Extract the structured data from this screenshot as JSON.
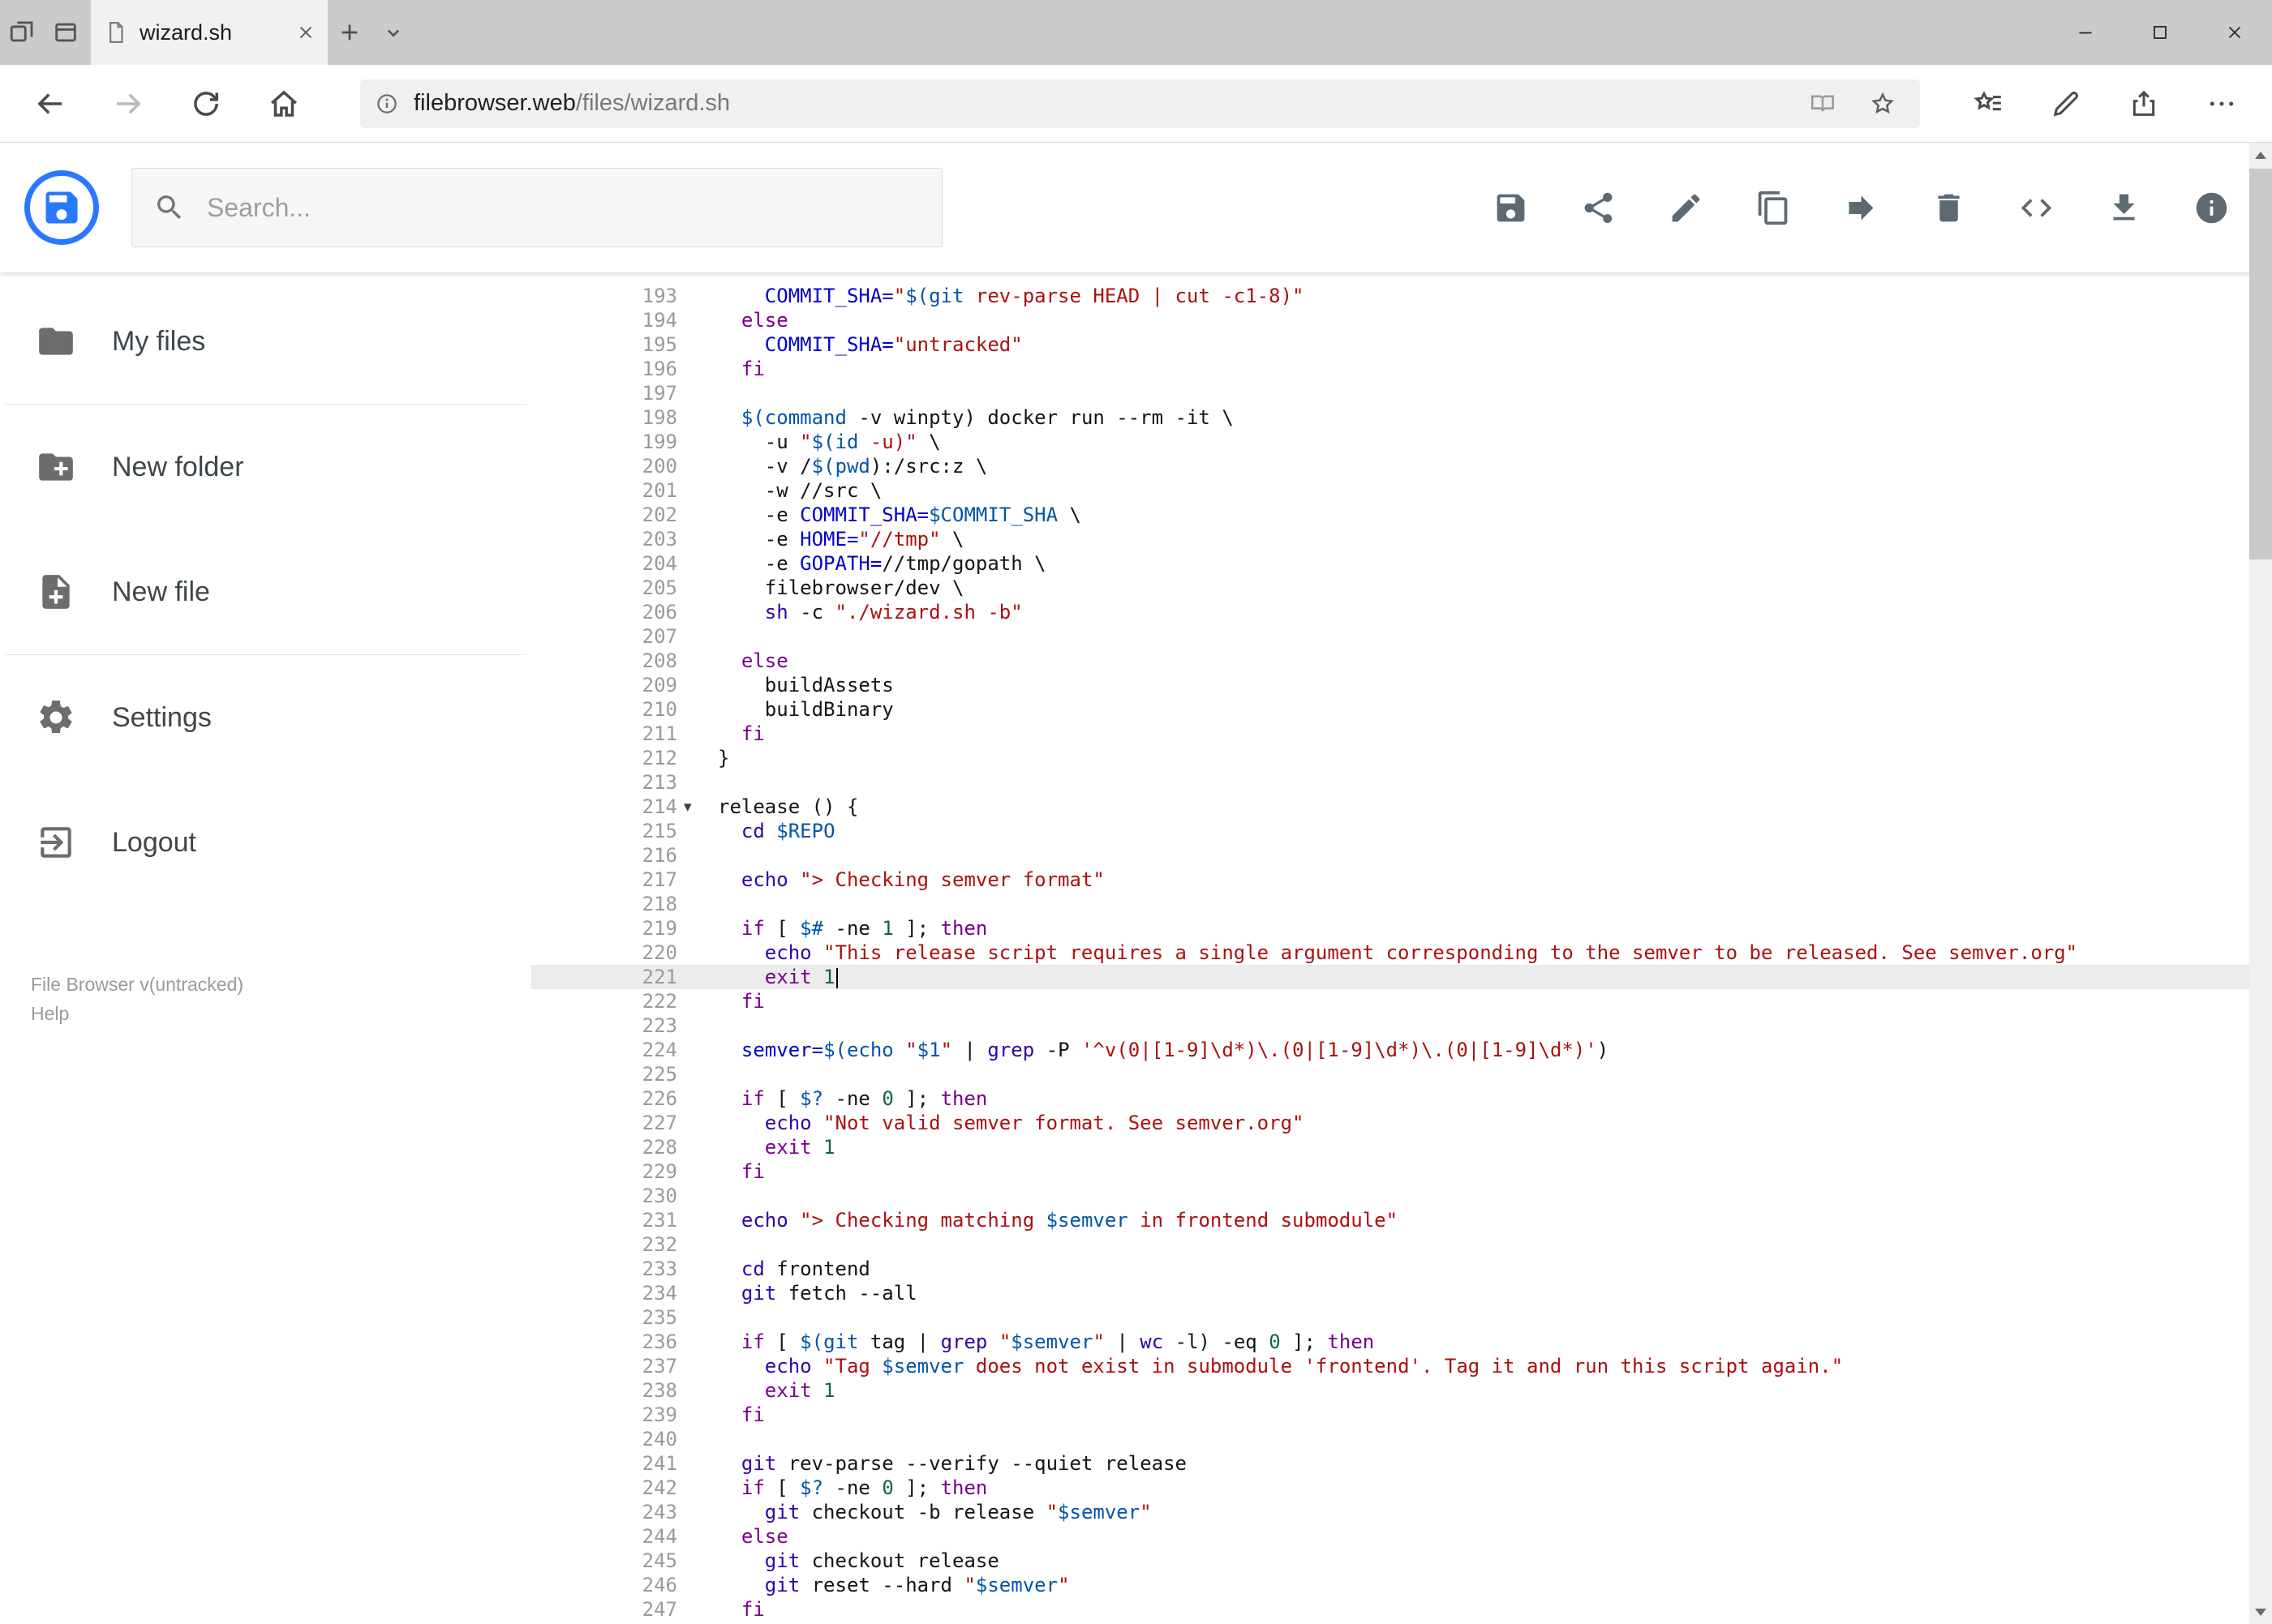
{
  "browser": {
    "tab": {
      "title": "wizard.sh"
    },
    "address": {
      "host": "filebrowser.web",
      "path": "/files/wizard.sh"
    },
    "titlebar_icons": [
      "set-tabs-aside-icon",
      "tabs-preview-icon",
      "new-tab-icon",
      "tab-preview-chevron-icon"
    ],
    "nav_icons": [
      "back-icon",
      "forward-icon",
      "refresh-icon",
      "home-icon",
      "info-icon",
      "reading-view-icon",
      "favorite-star-icon",
      "hub-icon",
      "annotate-pen-icon",
      "share-icon",
      "more-icon"
    ],
    "window_controls": [
      "minimize-icon",
      "maximize-icon",
      "close-icon"
    ]
  },
  "header": {
    "search": {
      "placeholder": "Search..."
    },
    "toolbar_icons": [
      "save-icon",
      "share-icon",
      "pencil-icon",
      "copy-icon",
      "move-icon",
      "trash-icon",
      "code-icon",
      "download-icon",
      "info-icon"
    ]
  },
  "sidebar": {
    "items": [
      {
        "label": "My files",
        "icon": "folder-icon"
      },
      {
        "label": "New folder",
        "icon": "new-folder-icon"
      },
      {
        "label": "New file",
        "icon": "new-file-icon"
      },
      {
        "label": "Settings",
        "icon": "settings-icon"
      },
      {
        "label": "Logout",
        "icon": "logout-icon"
      }
    ],
    "footer": {
      "version": "File Browser v(untracked)",
      "help": "Help"
    }
  },
  "editor": {
    "language": "shell",
    "first_line_number": 193,
    "last_line_number": 247,
    "active_line": 221,
    "folded_marker_line": 214,
    "cursor": {
      "line": 221,
      "after_text": "    exit 1"
    },
    "lines": [
      "    COMMIT_SHA=\"$(git rev-parse HEAD | cut -c1-8)\"",
      "  else",
      "    COMMIT_SHA=\"untracked\"",
      "  fi",
      "",
      "  $(command -v winpty) docker run --rm -it \\",
      "    -u \"$(id -u)\" \\",
      "    -v /$(pwd):/src:z \\",
      "    -w //src \\",
      "    -e COMMIT_SHA=$COMMIT_SHA \\",
      "    -e HOME=\"//tmp\" \\",
      "    -e GOPATH=//tmp/gopath \\",
      "    filebrowser/dev \\",
      "    sh -c \"./wizard.sh -b\"",
      "",
      "  else",
      "    buildAssets",
      "    buildBinary",
      "  fi",
      "}",
      "",
      "release () {",
      "  cd $REPO",
      "",
      "  echo \"> Checking semver format\"",
      "",
      "  if [ $# -ne 1 ]; then",
      "    echo \"This release script requires a single argument corresponding to the semver to be released. See semver.org\"",
      "    exit 1",
      "  fi",
      "",
      "  semver=$(echo \"$1\" | grep -P '^v(0|[1-9]\\d*)\\.(0|[1-9]\\d*)\\.(0|[1-9]\\d*)')",
      "",
      "  if [ $? -ne 0 ]; then",
      "    echo \"Not valid semver format. See semver.org\"",
      "    exit 1",
      "  fi",
      "",
      "  echo \"> Checking matching $semver in frontend submodule\"",
      "",
      "  cd frontend",
      "  git fetch --all",
      "",
      "  if [ $(git tag | grep \"$semver\" | wc -l) -eq 0 ]; then",
      "    echo \"Tag $semver does not exist in submodule 'frontend'. Tag it and run this script again.\"",
      "    exit 1",
      "  fi",
      "",
      "  git rev-parse --verify --quiet release",
      "  if [ $? -ne 0 ]; then",
      "    git checkout -b release \"$semver\"",
      "  else",
      "    git checkout release",
      "    git reset --hard \"$semver\"",
      "  fi"
    ]
  },
  "colors": {
    "brand_blue": "#2979ff",
    "titlebar_bg": "#cbcbcb",
    "addressbar_bg": "#f0f0f0",
    "active_line_bg": "#ececec",
    "syntax": {
      "keyword": "#770088",
      "string": "#aa1111",
      "variable": "#0055aa",
      "definition": "#0000cc",
      "number": "#116644",
      "builtin": "#3300aa",
      "line_number": "#9a9a9a"
    }
  }
}
